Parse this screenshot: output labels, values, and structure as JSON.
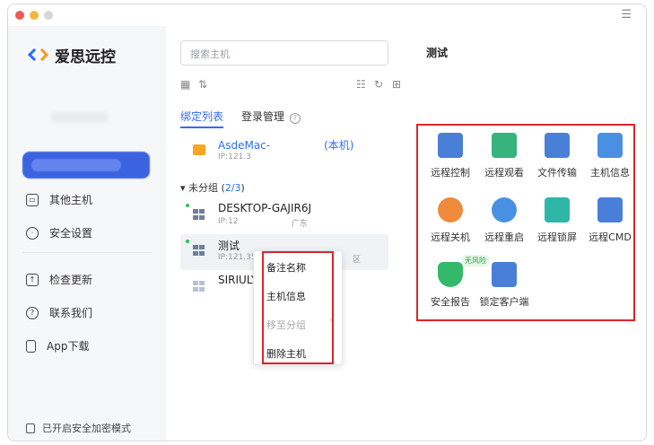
{
  "app": {
    "name": "爱思远控",
    "menu_icon": "hamburger-icon"
  },
  "sidebar": {
    "items": [
      {
        "label": "其他主机",
        "icon": "computer-icon"
      },
      {
        "label": "安全设置",
        "icon": "shield-icon"
      },
      {
        "label": "检查更新",
        "icon": "upload-icon"
      },
      {
        "label": "联系我们",
        "icon": "help-icon"
      },
      {
        "label": "App下载",
        "icon": "phone-icon"
      }
    ],
    "footer": "已开启安全加密模式"
  },
  "search": {
    "placeholder": "搜索主机"
  },
  "tabs": [
    {
      "label": "绑定列表",
      "active": true
    },
    {
      "label": "登录管理",
      "active": false
    }
  ],
  "local_host": {
    "name": "AsdeMac-",
    "tag": "(本机)",
    "ip": "IP:121.3"
  },
  "group": {
    "name": "未分组",
    "count": "2/3"
  },
  "hosts": [
    {
      "name": "DESKTOP-GAJIR6J",
      "ip": "IP:12",
      "location": "广东"
    },
    {
      "name": "测试",
      "ip": "IP:121.35.4",
      "location": "区"
    },
    {
      "name": "SIRIULY",
      "ip": "",
      "location": ""
    }
  ],
  "context_menu": {
    "items": [
      {
        "label": "备注名称",
        "enabled": true
      },
      {
        "label": "主机信息",
        "enabled": true
      },
      {
        "label": "移至分组",
        "enabled": false
      },
      {
        "label": "删除主机",
        "enabled": true
      }
    ]
  },
  "detail": {
    "title": "测试",
    "actions": [
      {
        "label": "远程控制",
        "color": "#4a7fd8"
      },
      {
        "label": "远程观看",
        "color": "#37b37e"
      },
      {
        "label": "文件传输",
        "color": "#4a7fd8"
      },
      {
        "label": "主机信息",
        "color": "#4a90e2"
      },
      {
        "label": "远程关机",
        "color": "#f08a3c"
      },
      {
        "label": "远程重启",
        "color": "#4a90e2"
      },
      {
        "label": "远程锁屏",
        "color": "#2fb6a8"
      },
      {
        "label": "远程CMD",
        "color": "#4a7fd8"
      },
      {
        "label": "安全报告",
        "color": "#34b86a",
        "badge": "无风险"
      },
      {
        "label": "锁定客户端",
        "color": "#4a7fd8"
      }
    ]
  },
  "colors": {
    "accent": "#2f6df6",
    "highlight_box": "#d9262b"
  }
}
